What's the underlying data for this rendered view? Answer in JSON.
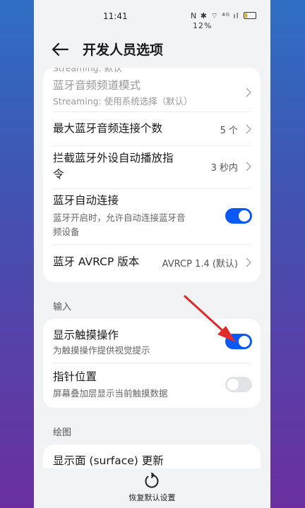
{
  "status_bar": {
    "time": "11:41",
    "indicator_icons": "N ✱ ⌔ ⁴ᴳ ıl",
    "battery_percent": "12%"
  },
  "header": {
    "title": "开发人员选项"
  },
  "bluetooth_card": {
    "cut_subtitle": "Streaming: 默认",
    "codec_mode": {
      "title": "蓝牙音频频道模式",
      "subtitle": "Streaming: 使用系统选择（默认）"
    },
    "max_connections": {
      "title": "最大蓝牙音频连接个数",
      "value": "5 个"
    },
    "block_autoplay": {
      "title_line1": "拦截蓝牙外设自动播放指",
      "title_line2": "令",
      "value": "3 秒内"
    },
    "auto_connect": {
      "title": "蓝牙自动连接",
      "subtitle_line1": "蓝牙开启时，允许自动连接蓝牙音",
      "subtitle_line2": "频设备",
      "enabled": true
    },
    "avrcp": {
      "title": "蓝牙 AVRCP 版本",
      "value": "AVRCP 1.4 (默认)"
    }
  },
  "input_section": {
    "label": "输入",
    "show_taps": {
      "title": "显示触摸操作",
      "subtitle": "为触摸操作提供视觉提示",
      "enabled": true
    },
    "pointer_location": {
      "title": "指针位置",
      "subtitle": "屏幕叠加层显示当前触摸数据",
      "enabled": false
    }
  },
  "drawing_section": {
    "label": "绘图",
    "surface_updates": {
      "title": "显示面 (surface) 更新"
    }
  },
  "bottom_bar": {
    "reset_label": "恢复默认设置"
  },
  "colors": {
    "accent": "#0a59f7",
    "annotation_arrow": "#e02b2b"
  }
}
